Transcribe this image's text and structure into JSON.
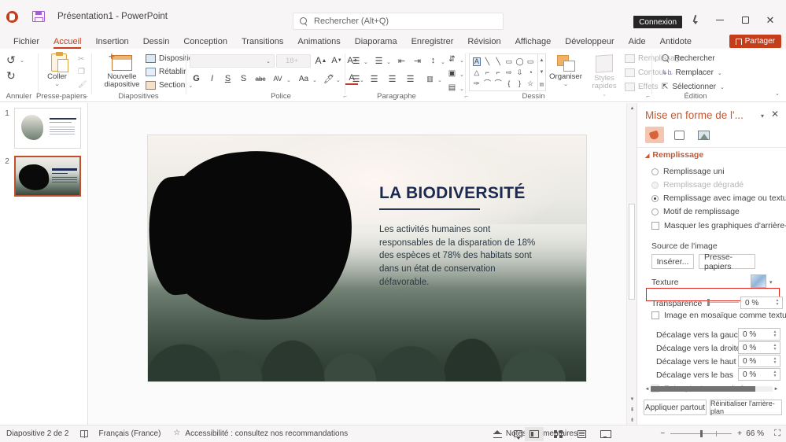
{
  "titlebar": {
    "app_icon": "powerpoint-icon",
    "save_icon": "save-icon",
    "document_title": "Présentation1  -  PowerPoint",
    "search_placeholder": "Rechercher (Alt+Q)",
    "connexion_label": "Connexion",
    "pen_icon": "pen-icon",
    "minimize_icon": "minimize-icon",
    "maximize_icon": "maximize-icon",
    "close_icon": "close-icon",
    "close_glyph": "✕"
  },
  "ribbon_tabs": [
    {
      "label": "Fichier",
      "active": false
    },
    {
      "label": "Accueil",
      "active": true
    },
    {
      "label": "Insertion",
      "active": false
    },
    {
      "label": "Dessin",
      "active": false
    },
    {
      "label": "Conception",
      "active": false
    },
    {
      "label": "Transitions",
      "active": false
    },
    {
      "label": "Animations",
      "active": false
    },
    {
      "label": "Diaporama",
      "active": false
    },
    {
      "label": "Enregistrer",
      "active": false
    },
    {
      "label": "Révision",
      "active": false
    },
    {
      "label": "Affichage",
      "active": false
    },
    {
      "label": "Développeur",
      "active": false
    },
    {
      "label": "Aide",
      "active": false
    },
    {
      "label": "Antidote",
      "active": false
    }
  ],
  "share_button": "Partager",
  "ribbon": {
    "groups": {
      "annuler": {
        "label": "Annuler",
        "undo_glyph": "↺",
        "redo_glyph": "↻",
        "caret": "⌄"
      },
      "presse_papiers": {
        "label": "Presse-papiers",
        "paste_label": "Coller",
        "caret": "⌄",
        "cut_glyph": "✂",
        "copy_glyph": "❐",
        "format_painter_glyph": "🖌",
        "dialog_launcher": "⌐"
      },
      "diapositives": {
        "label": "Diapositives",
        "new_slide_label": "Nouvelle diapositive",
        "caret": "⌄",
        "items": [
          "Disposition",
          "Rétablir",
          "Section"
        ]
      },
      "police": {
        "label": "Police",
        "font_name_value": "",
        "font_size_value": "18+",
        "grow_glyph": "A",
        "shrink_glyph": "A",
        "clear_glyph": "A",
        "bold_glyph": "G",
        "italic_glyph": "I",
        "underline_glyph": "S",
        "shadow_glyph": "S",
        "strike_glyph": "abc",
        "spacing_glyph": "AV",
        "case_glyph": "Aa",
        "highlight_glyph": "A",
        "color_glyph": "A",
        "dialog_launcher": "⌐"
      },
      "paragraphe": {
        "label": "Paragraphe",
        "bullets_glyph": "☰",
        "numbering_glyph": "☰",
        "dec_indent_glyph": "⇤",
        "inc_indent_glyph": "⇥",
        "line_spacing_glyph": "↕",
        "align_left_glyph": "☰",
        "align_center_glyph": "☰",
        "align_right_glyph": "☰",
        "justify_glyph": "☰",
        "columns_glyph": "▥",
        "text_dir_glyph": "⇵",
        "align_text_glyph": "▣",
        "smartart_glyph": "▤",
        "dialog_launcher": "⌐"
      },
      "dessin": {
        "label": "Dessin",
        "organiser_label": "Organiser",
        "quick_styles_label": "Styles rapides",
        "caret": "⌄",
        "fill_label": "Remplissage",
        "outline_label": "Contour",
        "effects_label": "Effets",
        "shapes": [
          "A",
          "╲",
          "╲",
          "▭",
          "◯",
          "▭",
          "△",
          "⌐",
          "⌐",
          "⇨",
          "⇩",
          "◺",
          "✑",
          "⌒",
          "⌒",
          "{",
          "}",
          "☆"
        ]
      },
      "edition": {
        "label": "Édition",
        "find_label": "Rechercher",
        "replace_label": "Remplacer",
        "select_label": "Sélectionner",
        "caret": "⌄"
      }
    },
    "collapse_caret": "⌄"
  },
  "thumbnails": [
    {
      "number": "1",
      "selected": false
    },
    {
      "number": "2",
      "selected": true
    }
  ],
  "slide": {
    "title": "LA BIODIVERSITÉ",
    "body": "Les activités humaines sont responsables de la disparation de 18% des espèces et 78% des habitats sont dans un état de conservation défavorable.",
    "title_color": "#1b2a52",
    "scroll_up_glyph": "▲",
    "scroll_down_glyph": "▼"
  },
  "format_pane": {
    "title": "Mise en forme de l'...",
    "dropdown_glyph": "▾",
    "close_glyph": "✕",
    "tabs": [
      {
        "icon": "fill-bucket-icon",
        "active": true
      },
      {
        "icon": "shape-effects-icon",
        "active": false
      },
      {
        "icon": "picture-icon",
        "active": false
      }
    ],
    "section_remplissage": {
      "title": "Remplissage",
      "collapse_glyph": "◢"
    },
    "fill_options": [
      {
        "label": "Remplissage uni",
        "checked": false,
        "disabled": false
      },
      {
        "label": "Remplissage dégradé",
        "checked": false,
        "disabled": true
      },
      {
        "label": "Remplissage avec image ou texture",
        "checked": true,
        "disabled": false,
        "highlighted": true
      },
      {
        "label": "Motif de remplissage",
        "checked": false,
        "disabled": false
      }
    ],
    "hide_bg_graphics": {
      "label": "Masquer les graphiques d'arrière-plan",
      "checked": false
    },
    "image_source": {
      "label": "Source de l'image",
      "insert_button": "Insérer...",
      "clipboard_button": "Presse-papiers"
    },
    "texture": {
      "label": "Texture",
      "caret": "▾"
    },
    "transparence": {
      "label": "Transparence",
      "value": "0 %"
    },
    "tile_checkbox": {
      "label": "Image en mosaïque comme texture",
      "checked": false
    },
    "offsets": [
      {
        "label": "Décalage vers la gauche",
        "value": "0 %"
      },
      {
        "label": "Décalage vers la droite",
        "value": "0 %"
      },
      {
        "label": "Décalage vers le haut",
        "value": "0 %"
      },
      {
        "label": "Décalage vers le bas",
        "value": "0 %"
      }
    ],
    "rotate_with_shape": {
      "label": "Faire pivoter avec la forme",
      "checked": false,
      "disabled": true
    },
    "hscroll": {
      "left_glyph": "◄",
      "right_glyph": "►"
    },
    "apply_all_button": "Appliquer partout",
    "reset_bg_button": "Réinitialiser l'arrière-plan",
    "highlight_color": "#e2241a",
    "accent_color": "#c05a35"
  },
  "statusbar": {
    "slide_indicator": "Diapositive 2 de 2",
    "notes_page_icon": "notes-page-icon",
    "language": "Français (France)",
    "accessibility": "Accessibilité : consultez nos recommandations",
    "notes_label": "Notes",
    "comments_label": "Commentaires",
    "views": [
      {
        "icon": "normal-view-icon",
        "active": true
      },
      {
        "icon": "slide-sorter-icon",
        "active": false
      },
      {
        "icon": "reading-view-icon",
        "active": false
      },
      {
        "icon": "slideshow-icon",
        "active": false
      }
    ],
    "zoom_out_glyph": "−",
    "zoom_in_glyph": "+",
    "zoom_level": "66 %",
    "fit_glyph": "⛶"
  }
}
